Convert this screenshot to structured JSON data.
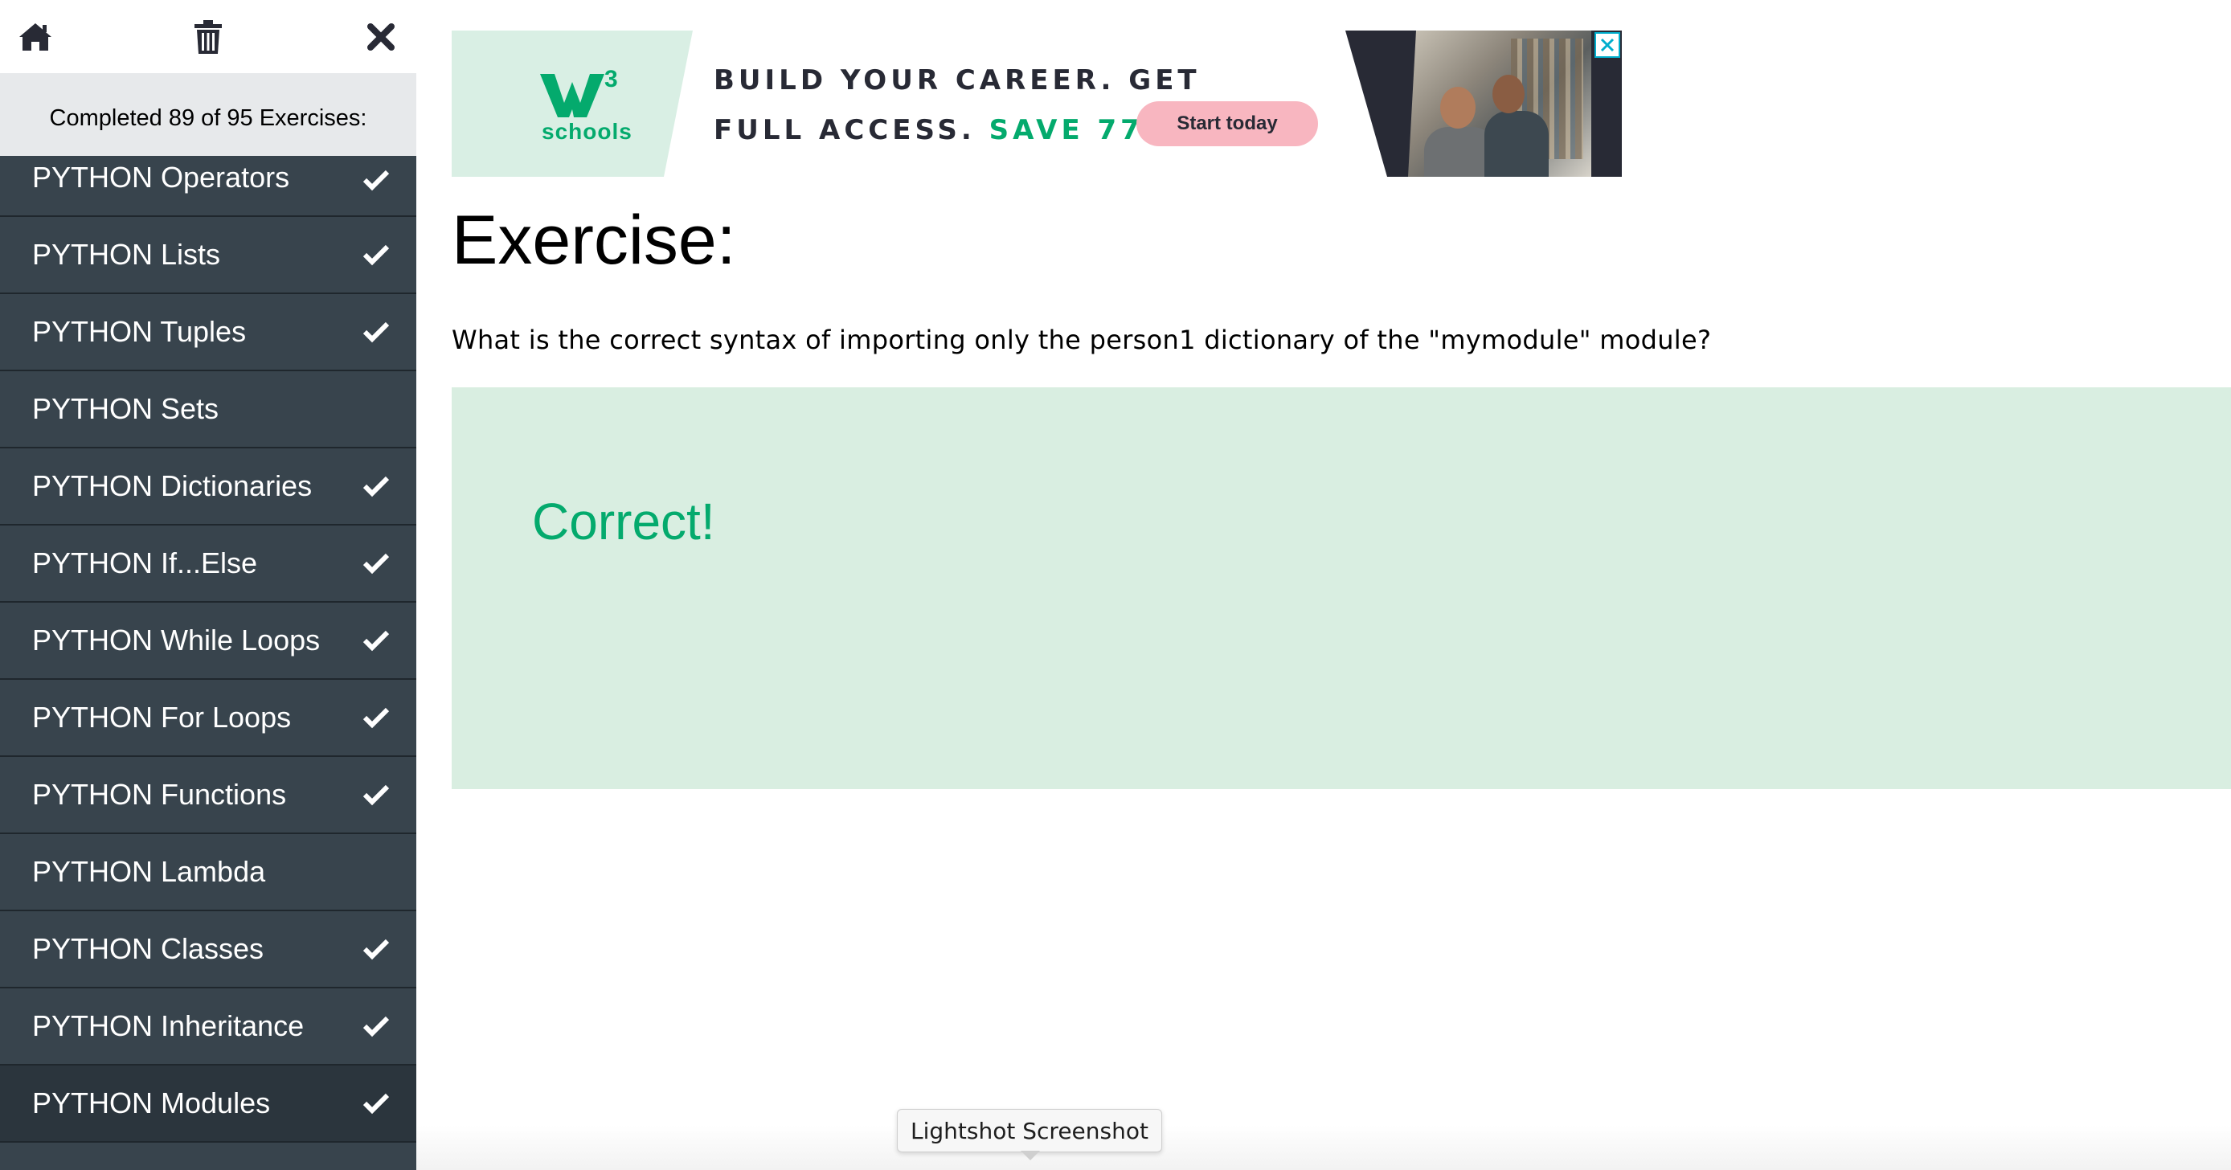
{
  "sidebar": {
    "top_icons": [
      "home-icon",
      "trash-icon",
      "close-icon"
    ],
    "progress_text": "Completed 89 of 95 Exercises:",
    "items": [
      {
        "label": "PYTHON Operators",
        "done": true
      },
      {
        "label": "PYTHON Lists",
        "done": true
      },
      {
        "label": "PYTHON Tuples",
        "done": true
      },
      {
        "label": "PYTHON Sets",
        "done": false
      },
      {
        "label": "PYTHON Dictionaries",
        "done": true
      },
      {
        "label": "PYTHON If...Else",
        "done": true
      },
      {
        "label": "PYTHON While Loops",
        "done": true
      },
      {
        "label": "PYTHON For Loops",
        "done": true
      },
      {
        "label": "PYTHON Functions",
        "done": true
      },
      {
        "label": "PYTHON Lambda",
        "done": false
      },
      {
        "label": "PYTHON Classes",
        "done": true
      },
      {
        "label": "PYTHON Inheritance",
        "done": true
      },
      {
        "label": "PYTHON Modules",
        "done": true,
        "active": true
      }
    ]
  },
  "ad": {
    "logo_mark": "3",
    "logo_text": "schools",
    "line1": "BUILD YOUR CAREER. GET",
    "line2_prefix": "FULL ACCESS.",
    "line2_highlight": "SAVE 770$",
    "cta": "Start today"
  },
  "main": {
    "title": "Exercise:",
    "question": "What is the correct syntax of importing only the person1 dictionary of the \"mymodule\" module?",
    "result": "Correct!"
  },
  "tooltip": "Lightshot Screenshot",
  "colors": {
    "sidebar_bg": "#38444d",
    "accent_green": "#04aa6d",
    "result_bg": "#d9eee1"
  }
}
